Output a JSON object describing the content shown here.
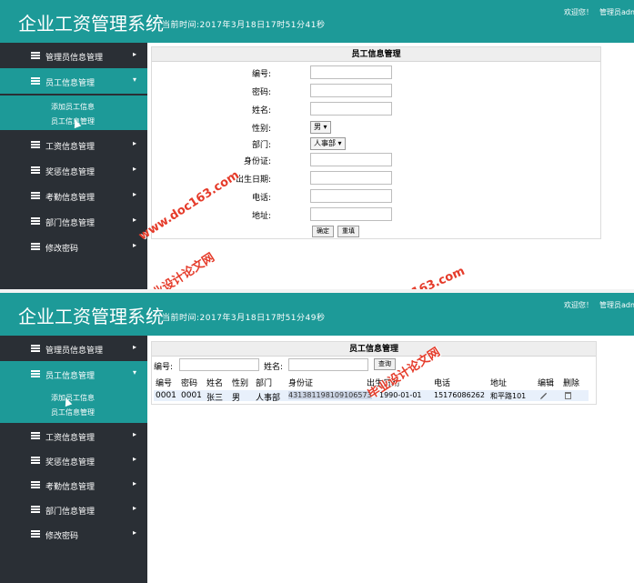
{
  "app": {
    "title": "企业工资管理系统",
    "welcome": "欢迎您！",
    "user": "管理员admin"
  },
  "screens": [
    {
      "time": "当前时间:2017年3月18日17时51分41秒"
    },
    {
      "time": "当前时间:2017年3月18日17时51分49秒"
    }
  ],
  "sidebar": {
    "items": [
      {
        "label": "管理员信息管理",
        "arrow": "▸"
      },
      {
        "label": "员工信息管理",
        "arrow": "▾"
      },
      {
        "label": "工资信息管理",
        "arrow": "▸"
      },
      {
        "label": "奖惩信息管理",
        "arrow": "▸"
      },
      {
        "label": "考勤信息管理",
        "arrow": "▸"
      },
      {
        "label": "部门信息管理",
        "arrow": "▸"
      },
      {
        "label": "修改密码",
        "arrow": "▸"
      }
    ],
    "submenu": [
      "添加员工信息",
      "员工信息管理"
    ]
  },
  "form": {
    "title": "员工信息管理",
    "fields": [
      {
        "label": "编号:"
      },
      {
        "label": "密码:"
      },
      {
        "label": "姓名:"
      },
      {
        "label": "性别:",
        "value": "男 ▾"
      },
      {
        "label": "部门:",
        "value": "人事部 ▾"
      },
      {
        "label": "身份证:"
      },
      {
        "label": "出生日期:"
      },
      {
        "label": "电话:"
      },
      {
        "label": "地址:"
      }
    ],
    "confirm": "确定",
    "reset": "重填"
  },
  "list": {
    "title": "员工信息管理",
    "search": {
      "id_label": "编号:",
      "name_label": "姓名:",
      "button": "查询"
    },
    "columns": [
      "编号",
      "密码",
      "姓名",
      "性别",
      "部门",
      "身份证",
      "出生日期",
      "电话",
      "地址",
      "编辑",
      "删除"
    ],
    "rows": [
      [
        "0001",
        "0001",
        "张三",
        "男",
        "人事部",
        "431381198109106573",
        "1990-01-01",
        "15176086262",
        "和平路101"
      ]
    ]
  },
  "watermarks": [
    "www.doc163.com",
    "毕业设计论文网"
  ],
  "colors": {
    "header": "#1d9a98",
    "sidebar": "#2a2f35",
    "watermark": "#e53b2a"
  }
}
